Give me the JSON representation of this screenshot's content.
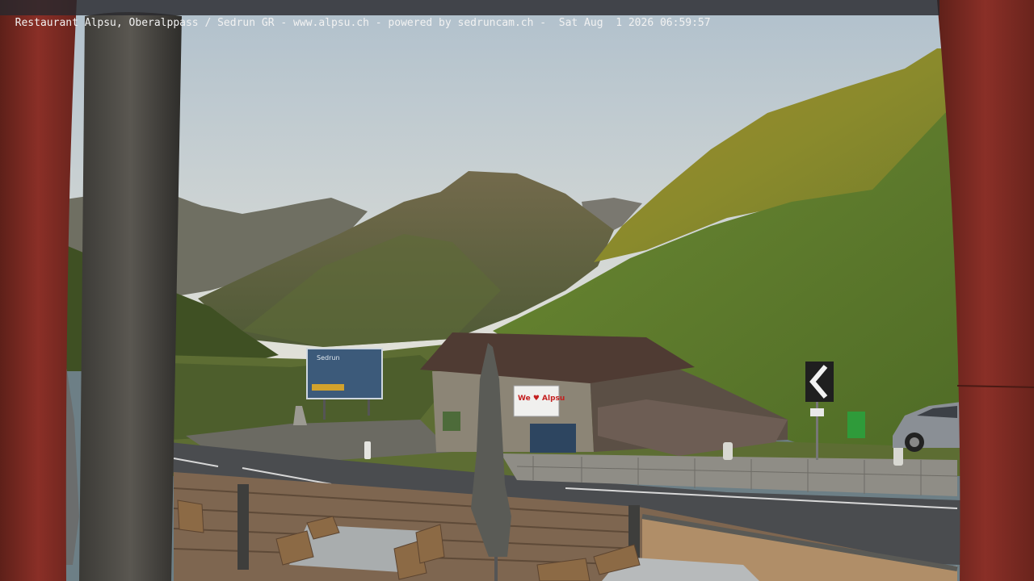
{
  "overlay": {
    "caption": "Restaurant Alpsu, Oberalppass / Sedrun GR - www.alpsu.ch - powered by sedruncam.ch -  Sat Aug  1 2026 06:59:57"
  },
  "signs": {
    "hut_banner": "We ♥ Alpsu",
    "billboard_title": "Sedrun"
  },
  "colors": {
    "sky_top": "#b5c4cf",
    "sky_bottom": "#dde1de",
    "sunlit_slope": "#9b8a2c",
    "grass": "#5e7a2d",
    "road": "#4a4c4f",
    "post_red": "#7a2a23",
    "deck_wood": "#8a6f52"
  }
}
